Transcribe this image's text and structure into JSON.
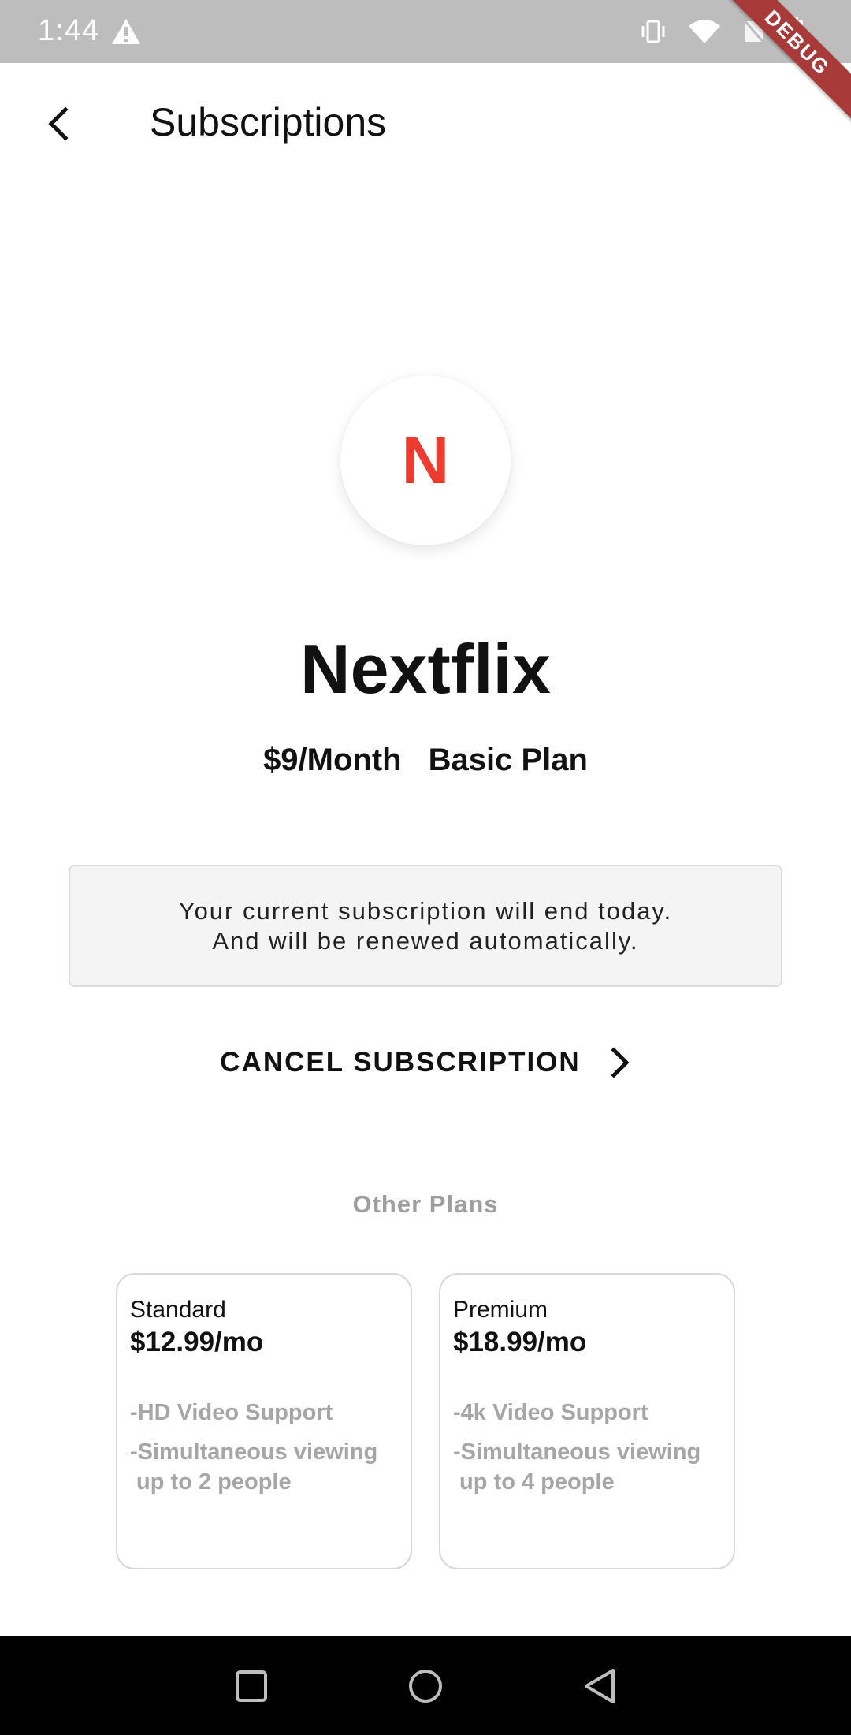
{
  "status_bar": {
    "time": "1:44"
  },
  "debug_banner": "DEBUG",
  "header": {
    "title": "Subscriptions"
  },
  "subscription": {
    "logo_letter": "N",
    "name": "Nextflix",
    "price": "$9/Month",
    "plan": "Basic Plan",
    "notice_line1": "Your current subscription will end today.",
    "notice_line2": "And will be renewed automatically.",
    "cancel_label": "CANCEL SUBSCRIPTION"
  },
  "other_plans": {
    "title": "Other Plans",
    "plans": [
      {
        "name": "Standard",
        "price": "$12.99/mo",
        "features": [
          "-HD Video Support",
          "-Simultaneous viewing\n up to 2 people"
        ]
      },
      {
        "name": "Premium",
        "price": "$18.99/mo",
        "features": [
          "-4k Video Support",
          "-Simultaneous viewing\n up to 4 people"
        ]
      }
    ]
  },
  "colors": {
    "brand": "#ee3b30",
    "muted": "#9e9e9e"
  }
}
